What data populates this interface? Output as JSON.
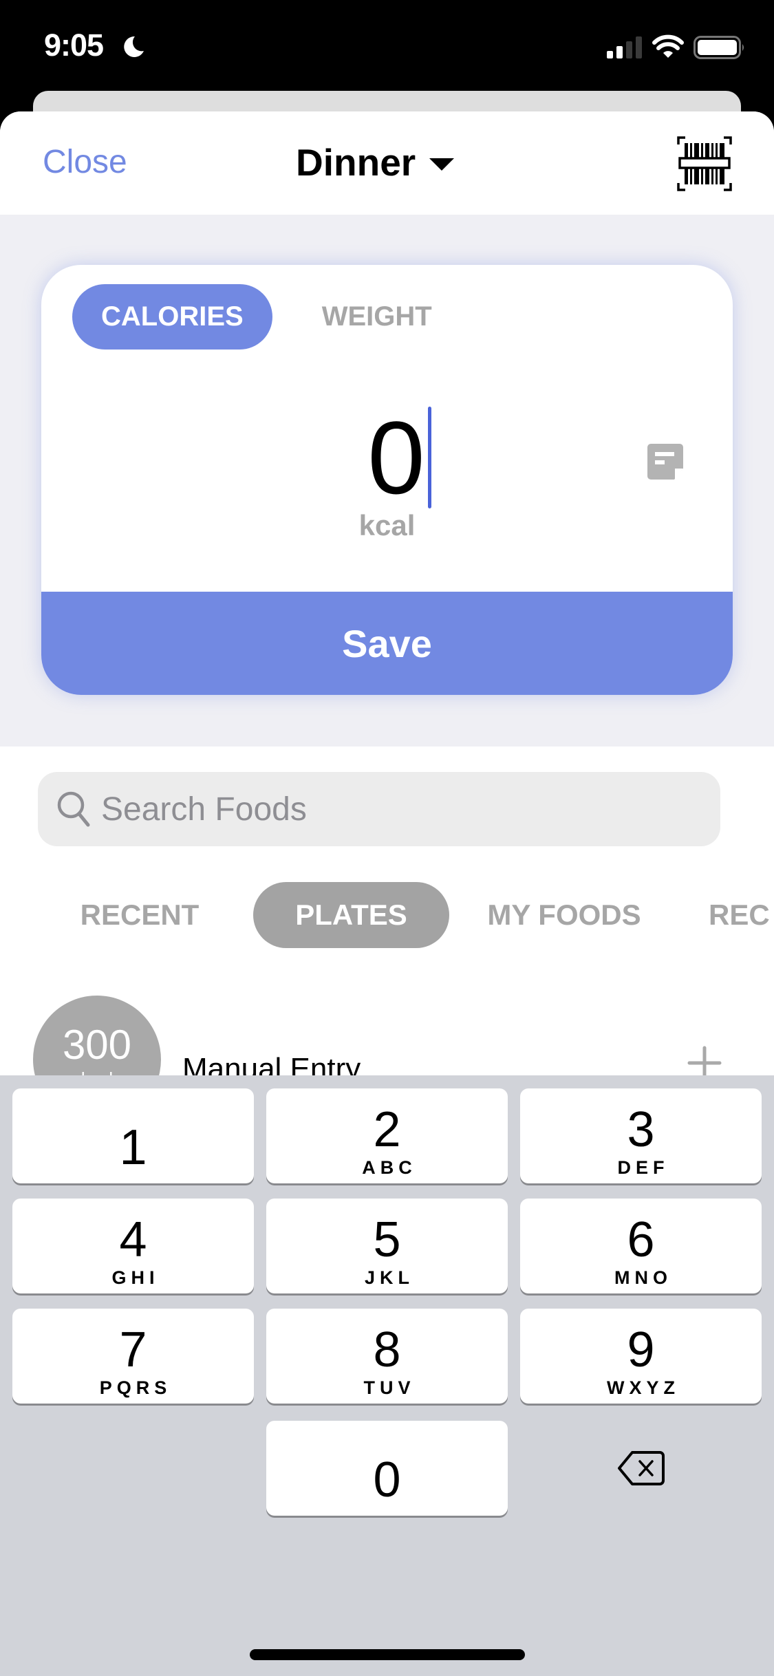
{
  "status_bar": {
    "time": "9:05",
    "focus_icon": "moon-icon",
    "signal_bars_active": 2,
    "signal_bars_total": 4,
    "wifi_icon": "wifi-icon",
    "battery_icon": "battery-icon"
  },
  "nav": {
    "close_label": "Close",
    "meal_title": "Dinner",
    "meal_dropdown_icon": "caret-down-icon",
    "barcode_icon": "barcode-scan-icon"
  },
  "entry": {
    "mode_tabs": [
      {
        "label": "CALORIES",
        "active": true
      },
      {
        "label": "WEIGHT",
        "active": false
      }
    ],
    "value": "0",
    "unit": "kcal",
    "note_icon": "note-icon",
    "save_label": "Save"
  },
  "search": {
    "placeholder": "Search Foods",
    "value": ""
  },
  "food_tabs": [
    {
      "label": "RECENT",
      "active": false
    },
    {
      "label": "PLATES",
      "active": true
    },
    {
      "label": "MY FOODS",
      "active": false
    },
    {
      "label": "REC",
      "active": false
    }
  ],
  "list": [
    {
      "kcal": "300",
      "kcal_unit": "kcal",
      "name": "Manual Entry",
      "action_icon": "plus-icon"
    }
  ],
  "keyboard": {
    "keys": [
      {
        "digit": "1",
        "letters": ""
      },
      {
        "digit": "2",
        "letters": "ABC"
      },
      {
        "digit": "3",
        "letters": "DEF"
      },
      {
        "digit": "4",
        "letters": "GHI"
      },
      {
        "digit": "5",
        "letters": "JKL"
      },
      {
        "digit": "6",
        "letters": "MNO"
      },
      {
        "digit": "7",
        "letters": "PQRS"
      },
      {
        "digit": "8",
        "letters": "TUV"
      },
      {
        "digit": "9",
        "letters": "WXYZ"
      },
      {
        "digit": "0",
        "letters": ""
      }
    ],
    "backspace_icon": "backspace-icon"
  },
  "colors": {
    "accent": "#7289e2",
    "cursor": "#4a63d9",
    "inactive_text": "#a6a6a6",
    "active_pill_gray": "#a3a3a3",
    "entry_bg": "#efeff4",
    "keyboard_bg": "#d1d3d9"
  }
}
